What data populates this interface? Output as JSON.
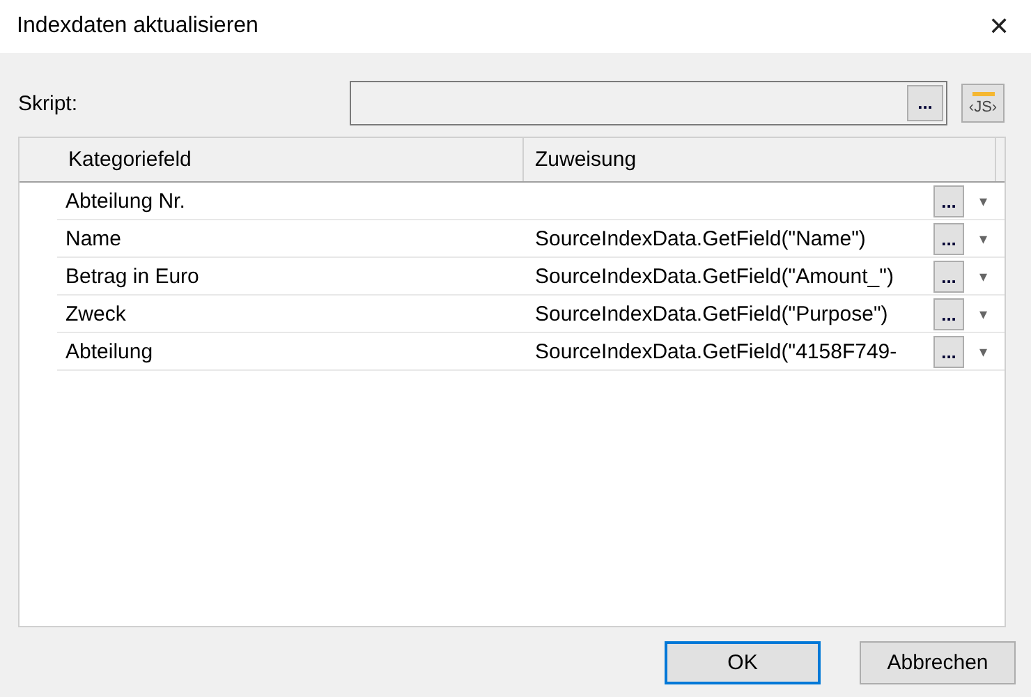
{
  "window": {
    "title": "Indexdaten aktualisieren",
    "close": "✕"
  },
  "script": {
    "label": "Skript:",
    "browse": "...",
    "js_button": "‹JS›"
  },
  "table": {
    "columns": [
      "Kategoriefeld",
      "Zuweisung"
    ],
    "rows": [
      {
        "field": "Abteilung Nr.",
        "browse": "...",
        "dropdown": "▾"
      },
      {
        "field": "Name",
        "assignment": "SourceIndexData.GetField(\"Name\")",
        "browse": "...",
        "dropdown": "▾"
      },
      {
        "field": "Betrag in Euro",
        "assignment": "SourceIndexData.GetField(\"Amount_\")",
        "browse": "...",
        "dropdown": "▾"
      },
      {
        "field": "Zweck",
        "assignment": "SourceIndexData.GetField(\"Purpose\")",
        "browse": "...",
        "dropdown": "▾"
      },
      {
        "field": "Abteilung",
        "assignment": "SourceIndexData.GetField(\"4158F749-",
        "browse": "...",
        "dropdown": "▾"
      }
    ]
  },
  "buttons": [
    {
      "label": "OK",
      "default": true
    },
    {
      "label": "Abbrechen",
      "default": false
    }
  ]
}
